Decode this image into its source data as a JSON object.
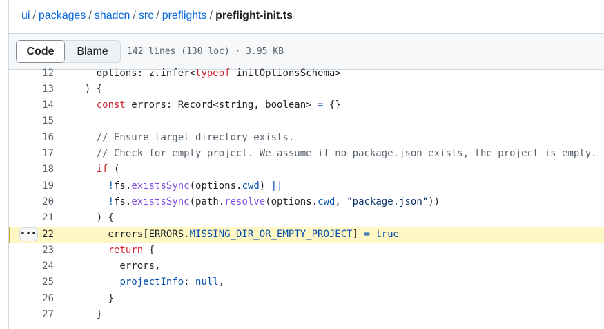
{
  "breadcrumb": {
    "items": [
      "ui",
      "packages",
      "shadcn",
      "src",
      "preflights"
    ],
    "separator": "/",
    "current": "preflight-init.ts"
  },
  "file_header": {
    "code_label": "Code",
    "blame_label": "Blame",
    "info": "142 lines (130 loc) · 3.95 KB"
  },
  "code": {
    "first_line": 12,
    "highlighted_line": 22,
    "line_menu_icon": "kebab-horizontal-icon",
    "line_menu_label": "•••",
    "colors": {
      "keyword": "#cf222e",
      "function": "#8250df",
      "constant": "#0550ae",
      "string": "#0a3069",
      "comment": "#59636e",
      "plain": "#1f2328"
    },
    "lines": [
      [
        {
          "t": "    options: z.infer<",
          "c": "plain"
        },
        {
          "t": "typeof",
          "c": "keyword"
        },
        {
          "t": " initOptionsSchema>",
          "c": "plain"
        }
      ],
      [
        {
          "t": "  ) {",
          "c": "plain"
        }
      ],
      [
        {
          "t": "    ",
          "c": "plain"
        },
        {
          "t": "const",
          "c": "keyword"
        },
        {
          "t": " errors: Record<string, boolean> ",
          "c": "plain"
        },
        {
          "t": "=",
          "c": "constant"
        },
        {
          "t": " {}",
          "c": "plain"
        }
      ],
      [],
      [
        {
          "t": "    // Ensure target directory exists.",
          "c": "comment"
        }
      ],
      [
        {
          "t": "    // Check for empty project. We assume if no package.json exists, the project is empty.",
          "c": "comment"
        }
      ],
      [
        {
          "t": "    ",
          "c": "plain"
        },
        {
          "t": "if",
          "c": "keyword"
        },
        {
          "t": " (",
          "c": "plain"
        }
      ],
      [
        {
          "t": "      ",
          "c": "plain"
        },
        {
          "t": "!",
          "c": "constant"
        },
        {
          "t": "fs.",
          "c": "plain"
        },
        {
          "t": "existsSync",
          "c": "function"
        },
        {
          "t": "(options.",
          "c": "plain"
        },
        {
          "t": "cwd",
          "c": "constant"
        },
        {
          "t": ") ",
          "c": "plain"
        },
        {
          "t": "||",
          "c": "constant"
        }
      ],
      [
        {
          "t": "      ",
          "c": "plain"
        },
        {
          "t": "!",
          "c": "constant"
        },
        {
          "t": "fs.",
          "c": "plain"
        },
        {
          "t": "existsSync",
          "c": "function"
        },
        {
          "t": "(path.",
          "c": "plain"
        },
        {
          "t": "resolve",
          "c": "function"
        },
        {
          "t": "(options.",
          "c": "plain"
        },
        {
          "t": "cwd",
          "c": "constant"
        },
        {
          "t": ", ",
          "c": "plain"
        },
        {
          "t": "\"package.json\"",
          "c": "string"
        },
        {
          "t": "))",
          "c": "plain"
        }
      ],
      [
        {
          "t": "    ) {",
          "c": "plain"
        }
      ],
      [
        {
          "t": "      errors[ERRORS.",
          "c": "plain"
        },
        {
          "t": "MISSING_DIR_OR_EMPTY_PROJECT",
          "c": "constant"
        },
        {
          "t": "] ",
          "c": "plain"
        },
        {
          "t": "=",
          "c": "constant"
        },
        {
          "t": " ",
          "c": "plain"
        },
        {
          "t": "true",
          "c": "constant"
        }
      ],
      [
        {
          "t": "      ",
          "c": "plain"
        },
        {
          "t": "return",
          "c": "keyword"
        },
        {
          "t": " {",
          "c": "plain"
        }
      ],
      [
        {
          "t": "        errors,",
          "c": "plain"
        }
      ],
      [
        {
          "t": "        ",
          "c": "plain"
        },
        {
          "t": "projectInfo",
          "c": "constant"
        },
        {
          "t": ": ",
          "c": "plain"
        },
        {
          "t": "null",
          "c": "constant"
        },
        {
          "t": ",",
          "c": "plain"
        }
      ],
      [
        {
          "t": "      }",
          "c": "plain"
        }
      ],
      [
        {
          "t": "    }",
          "c": "plain"
        }
      ]
    ]
  }
}
